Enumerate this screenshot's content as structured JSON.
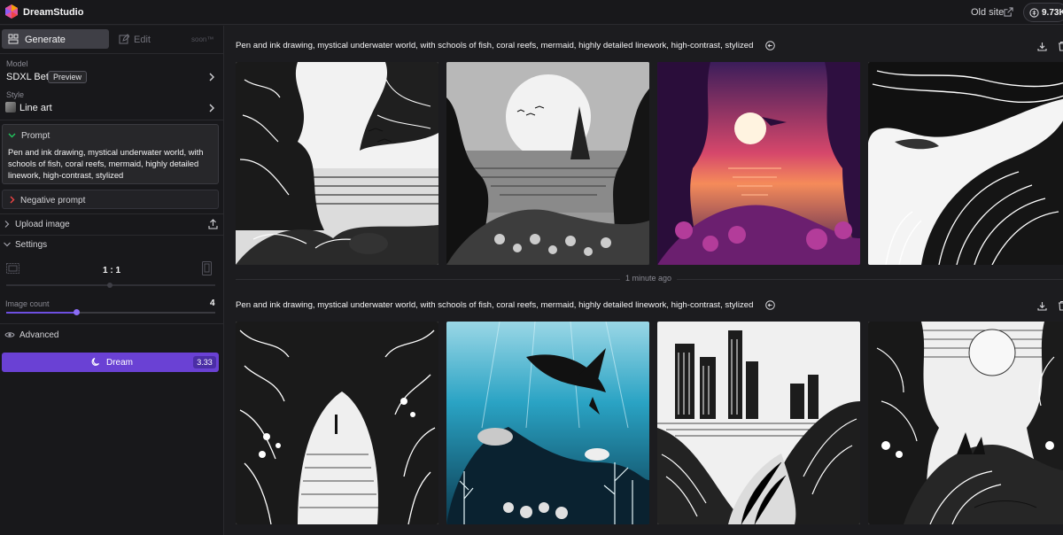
{
  "app": {
    "name": "DreamStudio"
  },
  "header": {
    "old_site_label": "Old site",
    "credits": "9.73K"
  },
  "sidebar": {
    "tabs": {
      "generate": "Generate",
      "edit": "Edit",
      "edit_note": "soon™"
    },
    "model": {
      "label": "Model",
      "value": "SDXL Beta",
      "badge": "Preview"
    },
    "style": {
      "label": "Style",
      "value": "Line art"
    },
    "prompt": {
      "title": "Prompt",
      "text": "Pen and ink drawing, mystical underwater world, with schools of fish, coral reefs, mermaid, highly detailed linework, high-contrast, stylized"
    },
    "negative_prompt": {
      "title": "Negative prompt"
    },
    "upload": {
      "title": "Upload image"
    },
    "settings": {
      "title": "Settings",
      "aspect_ratio": "1 : 1",
      "image_count_label": "Image count",
      "image_count": "4",
      "image_count_max": 10
    },
    "advanced": {
      "title": "Advanced"
    },
    "dream": {
      "label": "Dream",
      "cost": "3.33"
    }
  },
  "main": {
    "generations": [
      {
        "prompt": "Pen and ink drawing, mystical underwater world, with schools of fish, coral reefs, mermaid, highly detailed linework, high-contrast, stylized",
        "images": [
          "forest-shore-ink",
          "moon-bay-ink",
          "purple-sunset-reef",
          "swirling-waves-fish"
        ]
      },
      {
        "prompt": "Pen and ink drawing, mystical underwater world, with schools of fish, coral reefs, mermaid, highly detailed linework, high-contrast, stylized",
        "images": [
          "cave-figure-ink",
          "blue-underwater-mermaid",
          "city-skyline-ink",
          "sun-swirls-ink"
        ]
      }
    ],
    "divider_time": "1 minute ago"
  },
  "colors": {
    "accent": "#6a41d4",
    "background": "#1c1c1f",
    "sidebar": "#18181b"
  }
}
